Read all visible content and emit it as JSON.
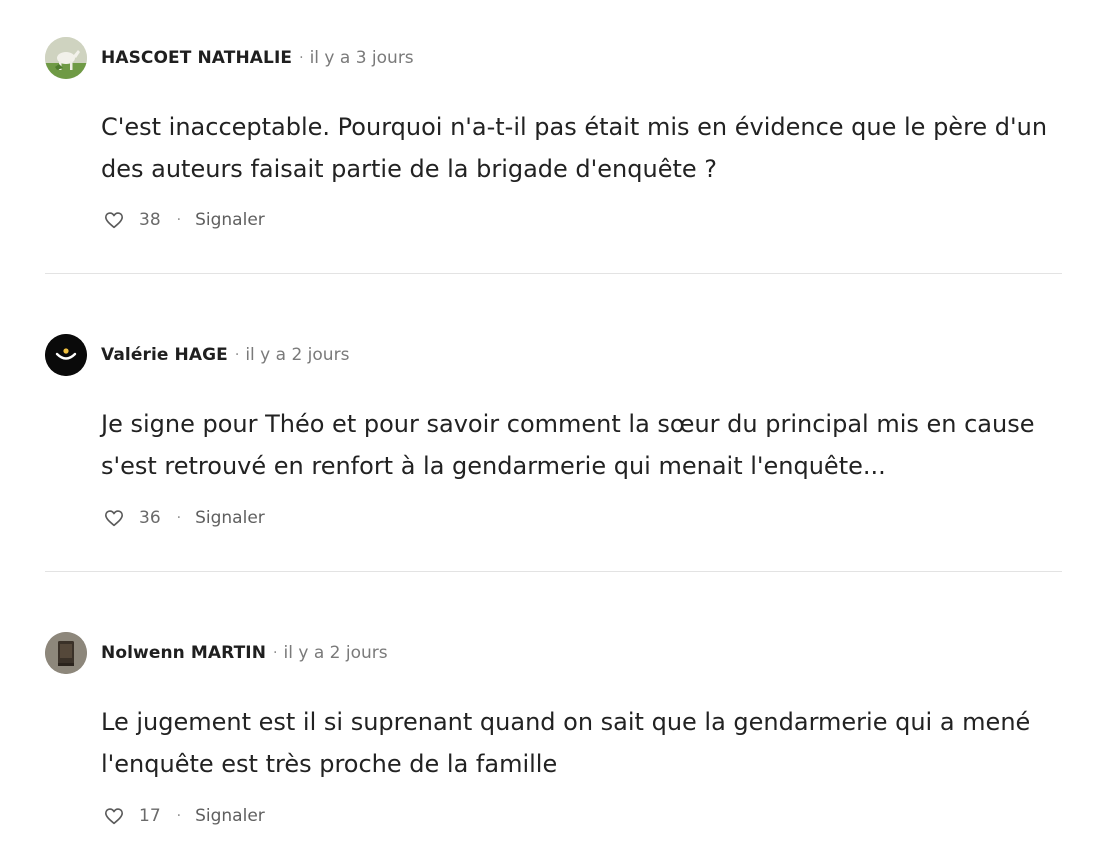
{
  "comments": [
    {
      "author": "HASCOET NATHALIE",
      "separator": "·",
      "time": "il y a 3 jours",
      "text": "C'est inacceptable. Pourquoi n'a-t-il pas était mis en évidence que le père d'un des auteurs faisait partie de la brigade d'enquête ?",
      "likes": "38",
      "action_separator": "·",
      "report_label": "Signaler",
      "avatar_icon": "horse-avatar",
      "like_icon": "heart-icon"
    },
    {
      "author": "Valérie HAGE",
      "separator": "·",
      "time": "il y a 2 jours",
      "text": "Je signe pour Théo et pour savoir comment la sœur du principal mis en cause s'est retrouvé en renfort à la gendarmerie qui menait l'enquête...",
      "likes": "36",
      "action_separator": "·",
      "report_label": "Signaler",
      "avatar_icon": "smile-avatar",
      "like_icon": "heart-icon"
    },
    {
      "author": "Nolwenn MARTIN",
      "separator": "·",
      "time": "il y a 2 jours",
      "text": "Le jugement est il si suprenant quand on sait que la gendarmerie qui a mené l'enquête est très proche de la famille",
      "likes": "17",
      "action_separator": "·",
      "report_label": "Signaler",
      "avatar_icon": "book-avatar",
      "like_icon": "heart-icon"
    }
  ],
  "colors": {
    "text": "#222222",
    "muted": "#7a7a7a",
    "divider": "#e3e3e3"
  }
}
